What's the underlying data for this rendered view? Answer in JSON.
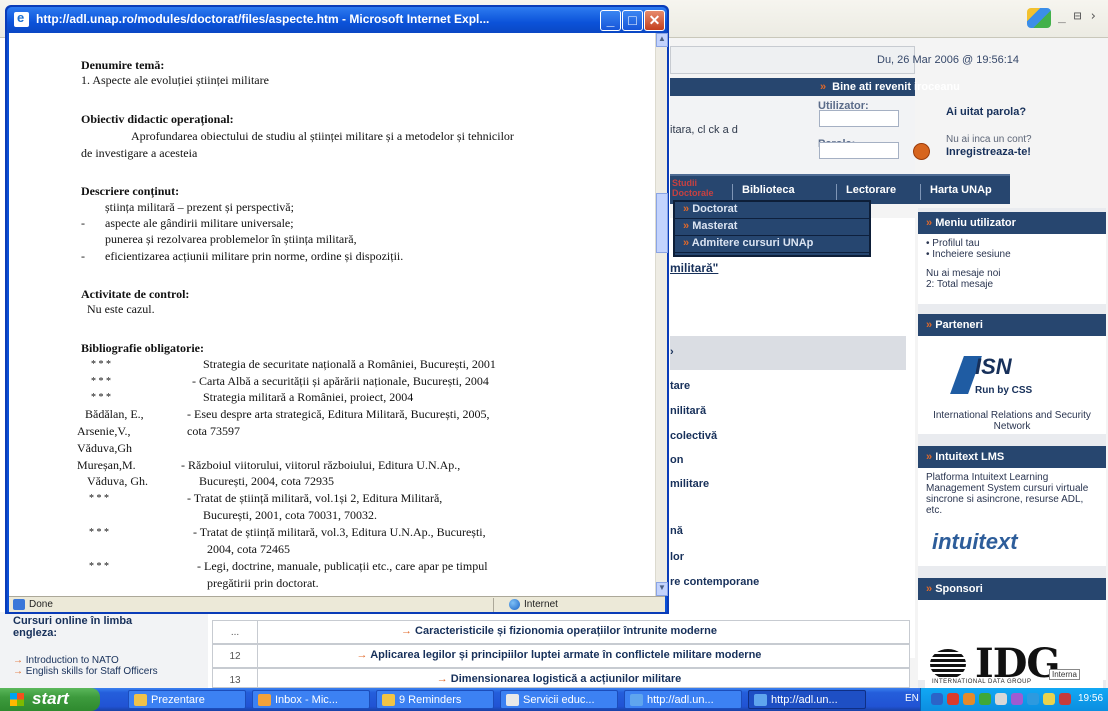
{
  "background_page": {
    "date": "Du, 26 Mar 2006 @ 19:56:14",
    "welcome": "Bine ati revenit iroceanu",
    "login": {
      "intro_text": "itara, cl ck a d",
      "user_label": "Utilizator:",
      "pass_label": "Parola:",
      "forgot": "Ai uitat parola?",
      "new_account": "Nu ai inca un cont?",
      "register": "Inregistreaza-te!"
    },
    "nav": {
      "red_label": "Studii\nDoctorale",
      "items": [
        "Biblioteca",
        "Lectorare",
        "Harta UNAp"
      ]
    },
    "dropdown": [
      "Doctorat",
      "Masterat",
      "Admitere cursuri UNAp"
    ],
    "main": {
      "heading_link": "militară\"",
      "links": [
        "tare",
        "nilitară",
        "colectivă",
        "on",
        "militare",
        "nă",
        "lor",
        "re contemporane"
      ]
    },
    "table_rows": [
      {
        "num": "...",
        "text": "Caracteristicile și fizionomia operațiilor întrunite moderne"
      },
      {
        "num": "12",
        "text": "Aplicarea legilor și principiilor luptei armate în conflictele militare moderne"
      },
      {
        "num": "13",
        "text": "Dimensionarea logistică a acțiunilor militare"
      }
    ],
    "left_panel": {
      "title": "Cursuri online în limba engleza:",
      "links": [
        "Introduction to NATO",
        "English skills for Staff Officers"
      ]
    },
    "right_modules": {
      "user_menu": {
        "title": "Meniu utilizator",
        "items": [
          "Profilul tau",
          "Incheiere sesiune"
        ],
        "messages": "Nu ai mesaje noi\n2: Total mesaje"
      },
      "partners": {
        "title": "Parteneri",
        "isn_logo": "ISN",
        "isn_sub": "Run by CSS",
        "isn_caption": "International Relations and Security Network"
      },
      "intuitext": {
        "title": "Intuitext LMS",
        "text": "Platforma Intuitext Learning Management System cursuri virtuale sincrone si asincrone, resurse ADL, etc.",
        "logo": "intuitext"
      },
      "sponsor": {
        "title": "Sponsori",
        "logo": "IDG",
        "logo_sub": "INTERNATIONAL DATA GROUP",
        "tooltip": "Interna"
      }
    }
  },
  "popup": {
    "title": "http://adl.unap.ro/modules/doctorat/files/aspecte.htm - Microsoft Internet Expl...",
    "status_left": "Done",
    "status_right": "Internet",
    "doc": {
      "h_tema": "Denumire temă:",
      "tema_line": "1.   Aspecte ale evoluției științei militare",
      "h_obiectiv": "Obiectiv didactic operațional:",
      "obiectiv_l1": "Aprofundarea obiectului de studiu al științei militare și a metodelor și tehnicilor",
      "obiectiv_l2": "de investigare a acesteia",
      "h_continut": "Descriere conținut:",
      "continut": [
        "știința militară – prezent și perspectivă;",
        "aspecte ale gândirii militare universale;",
        "punerea și rezolvarea problemelor în știința militară,",
        "eficientizarea acțiunii militare prin norme, ordine și dispoziții."
      ],
      "h_control": "Activitate de control:",
      "control": "Nu este cazul.",
      "h_biblio": "Bibliografie obligatorie:",
      "biblio": [
        {
          "a": "* * *",
          "t": "Strategia de securitate națională a României, București, 2001"
        },
        {
          "a": "* * *",
          "t": "- Carta Albă a securității și apărării naționale, București, 2004"
        },
        {
          "a": "* * *",
          "t": "Strategia militară a României, proiect, 2004"
        },
        {
          "a": "Bădălan, E.,",
          "t": "- Eseu despre arta strategică, Editura Militară, București, 2005,"
        },
        {
          "a": "Arsenie,V.,",
          "t": "cota 73597"
        },
        {
          "a": "Văduva,Gh",
          "t": ""
        },
        {
          "a": "Mureșan,M.",
          "t": "- Războiul viitorului, viitorul războiului, Editura U.N.Ap.,"
        },
        {
          "a": "Văduva, Gh.",
          "t": "București, 2004, cota 72935"
        },
        {
          "a": "* * *",
          "t": "- Tratat de știință militară, vol.1și 2, Editura Militară,"
        },
        {
          "a": "",
          "t": "București, 2001, cota 70031, 70032."
        },
        {
          "a": "* * *",
          "t": "- Tratat de știință militară, vol.3, Editura U.N.Ap., București,"
        },
        {
          "a": "",
          "t": "2004, cota 72465"
        },
        {
          "a": "* * *",
          "t": "- Legi, doctrine, manuale, publicații etc., care apar pe timpul"
        },
        {
          "a": "",
          "t": "pregătirii prin doctorat."
        }
      ]
    }
  },
  "taskbar": {
    "start": "start",
    "tasks": [
      "Prezentare",
      "Inbox - Mic...",
      "9 Reminders",
      "Servicii educ...",
      "http://adl.un...",
      "http://adl.un..."
    ],
    "lang": "EN",
    "time": "19:56"
  },
  "colors": {
    "nav_blue": "#27466f",
    "accent_orange": "#e0692a",
    "xp_title_blue": "#0b52d9",
    "taskbar_blue": "#245edb"
  }
}
